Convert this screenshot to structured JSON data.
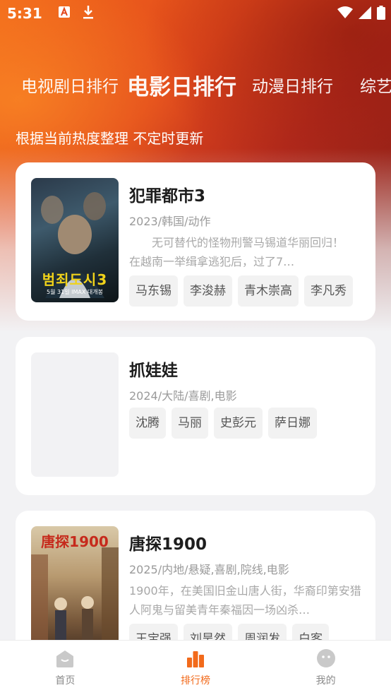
{
  "status": {
    "time": "5:31"
  },
  "tabs": [
    {
      "label": "电视剧日排行"
    },
    {
      "label": "电影日排行"
    },
    {
      "label": "动漫日排行"
    },
    {
      "label": "综艺"
    }
  ],
  "subtitle": "根据当前热度整理 不定时更新",
  "movies": [
    {
      "title": "犯罪都市3",
      "meta": "2023/韩国/动作",
      "desc": "　　无可替代的怪物刑警马锡道华丽回归！　　在越南一举缉拿逃犯后，过了7…",
      "tags": [
        "马东锡",
        "李浚赫",
        "青木崇高",
        "李凡秀"
      ],
      "poster_text": "범죄도시3",
      "poster_sub": "5월 31일 IMAX 대개봉"
    },
    {
      "title": "抓娃娃",
      "meta": "2024/大陆/喜剧,电影",
      "desc": "",
      "tags": [
        "沈腾",
        "马丽",
        "史彭元",
        "萨日娜"
      ]
    },
    {
      "title": "唐探1900",
      "meta": "2025/内地/悬疑,喜剧,院线,电影",
      "desc": "1900年，在美国旧金山唐人街，华裔印第安猎人阿鬼与留美青年秦福因一场凶杀…",
      "tags": [
        "王宝强",
        "刘昊然",
        "周润发",
        "白客"
      ],
      "poster_text": "唐探1900"
    }
  ],
  "nav": [
    {
      "label": "首页"
    },
    {
      "label": "排行榜"
    },
    {
      "label": "我的"
    }
  ],
  "colors": {
    "accent": "#f26a1b",
    "nav_inactive": "#8a8a8a"
  }
}
